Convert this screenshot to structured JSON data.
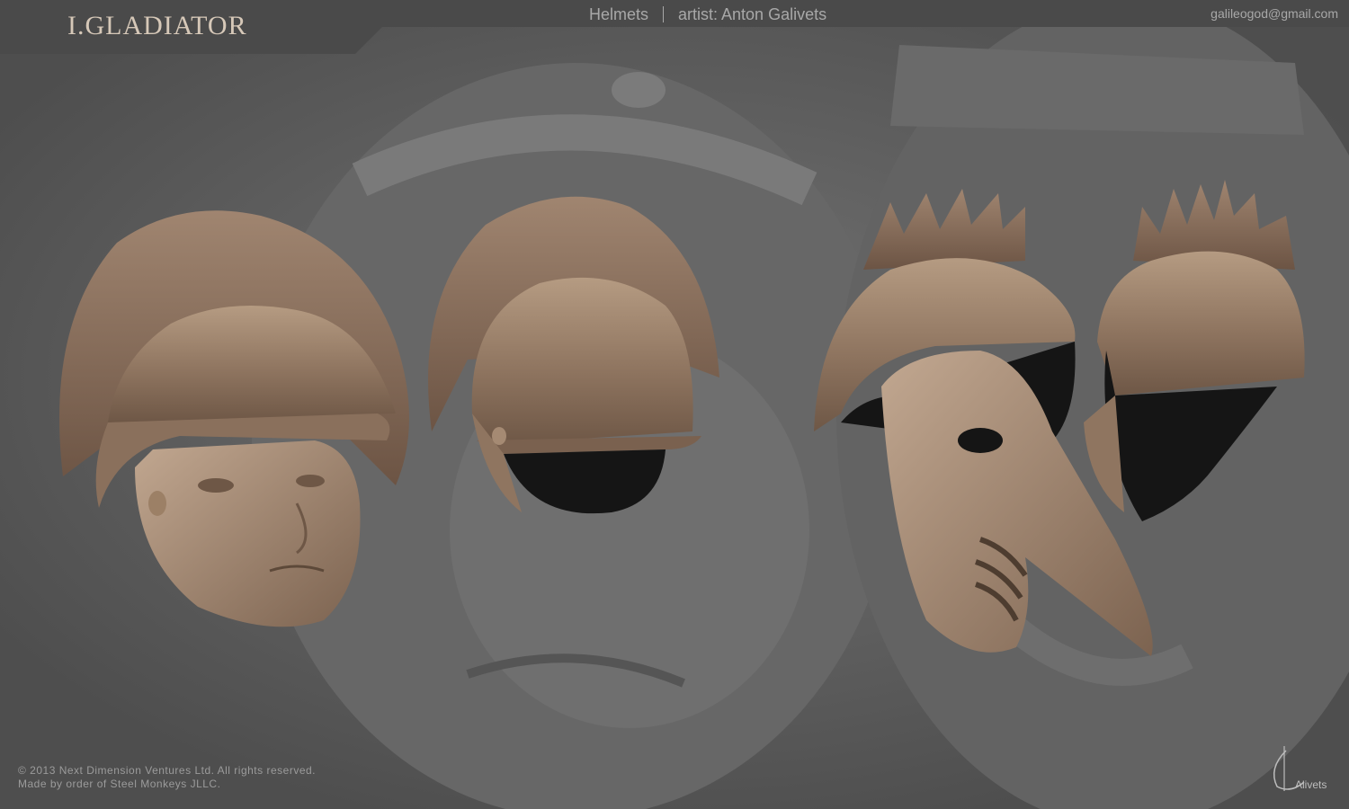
{
  "header": {
    "logo": "I.GLADIATOR",
    "category": "Helmets",
    "artist": "artist: Anton Galivets",
    "email": "galileogod@gmail.com"
  },
  "footer": {
    "copyright": "© 2013 Next Dimension Ventures Ltd. All rights reserved.",
    "credit": "Made by order of Steel Monkeys JLLC."
  },
  "signature": "Alivets",
  "colors": {
    "background": "#5e5e5e",
    "header_bar": "#4a4a4a",
    "model_clay": "#9c8066",
    "logo_text": "#d6c8b8"
  },
  "models": [
    "crested-face-helmet-front",
    "crested-helmet-back",
    "beak-mask-helmet-front",
    "beak-mask-helmet-back"
  ]
}
